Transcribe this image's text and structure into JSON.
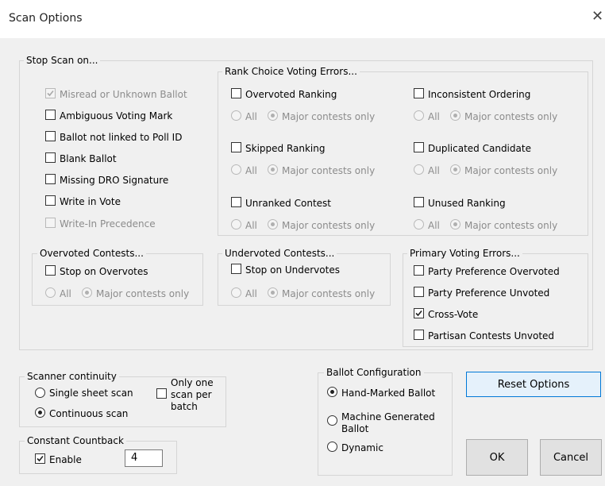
{
  "window": {
    "title": "Scan Options",
    "close_glyph": "✕"
  },
  "stop_scan": {
    "legend": "Stop Scan on...",
    "items": [
      {
        "label": "Misread or Unknown Ballot",
        "checked": true,
        "disabled": true
      },
      {
        "label": "Ambiguous Voting Mark",
        "checked": false,
        "disabled": false
      },
      {
        "label": "Ballot not linked to Poll ID",
        "checked": false,
        "disabled": false
      },
      {
        "label": "Blank Ballot",
        "checked": false,
        "disabled": false
      },
      {
        "label": "Missing DRO Signature",
        "checked": false,
        "disabled": false
      },
      {
        "label": "Write in Vote",
        "checked": false,
        "disabled": false
      },
      {
        "label": "Write-In Precedence",
        "checked": false,
        "disabled": true
      }
    ]
  },
  "rcv": {
    "legend": "Rank Choice Voting Errors...",
    "items": [
      {
        "label": "Overvoted Ranking",
        "all": "All",
        "major": "Major contests only"
      },
      {
        "label": "Inconsistent Ordering",
        "all": "All",
        "major": "Major contests only"
      },
      {
        "label": "Skipped Ranking",
        "all": "All",
        "major": "Major contests only"
      },
      {
        "label": "Duplicated Candidate",
        "all": "All",
        "major": "Major contests only"
      },
      {
        "label": "Unranked Contest",
        "all": "All",
        "major": "Major contests only"
      },
      {
        "label": "Unused Ranking",
        "all": "All",
        "major": "Major contests only"
      }
    ]
  },
  "overvoted": {
    "legend": "Overvoted Contests...",
    "check": "Stop on Overvotes",
    "all": "All",
    "major": "Major contests only"
  },
  "undervoted": {
    "legend": "Undervoted Contests...",
    "check": "Stop on Undervotes",
    "all": "All",
    "major": "Major contests only"
  },
  "primary": {
    "legend": "Primary Voting Errors...",
    "items": [
      {
        "label": "Party Preference Overvoted",
        "checked": false
      },
      {
        "label": "Party Preference Unvoted",
        "checked": false
      },
      {
        "label": "Cross-Vote",
        "checked": true
      },
      {
        "label": "Partisan Contests Unvoted",
        "checked": false
      }
    ]
  },
  "scanner": {
    "legend": "Scanner continuity",
    "single": "Single sheet scan",
    "continuous": "Continuous scan",
    "selected": "continuous",
    "only_one": {
      "line1": "Only one",
      "line2": "scan per",
      "line3": "batch",
      "checked": false
    }
  },
  "countback": {
    "legend": "Constant Countback",
    "enable": "Enable",
    "enabled": true,
    "value": "4"
  },
  "ballot_config": {
    "legend": "Ballot Configuration",
    "hand": "Hand-Marked Ballot",
    "machine_line1": "Machine Generated",
    "machine_line2": "Ballot",
    "dynamic": "Dynamic",
    "selected": "hand"
  },
  "buttons": {
    "reset": "Reset Options",
    "ok": "OK",
    "cancel": "Cancel"
  }
}
